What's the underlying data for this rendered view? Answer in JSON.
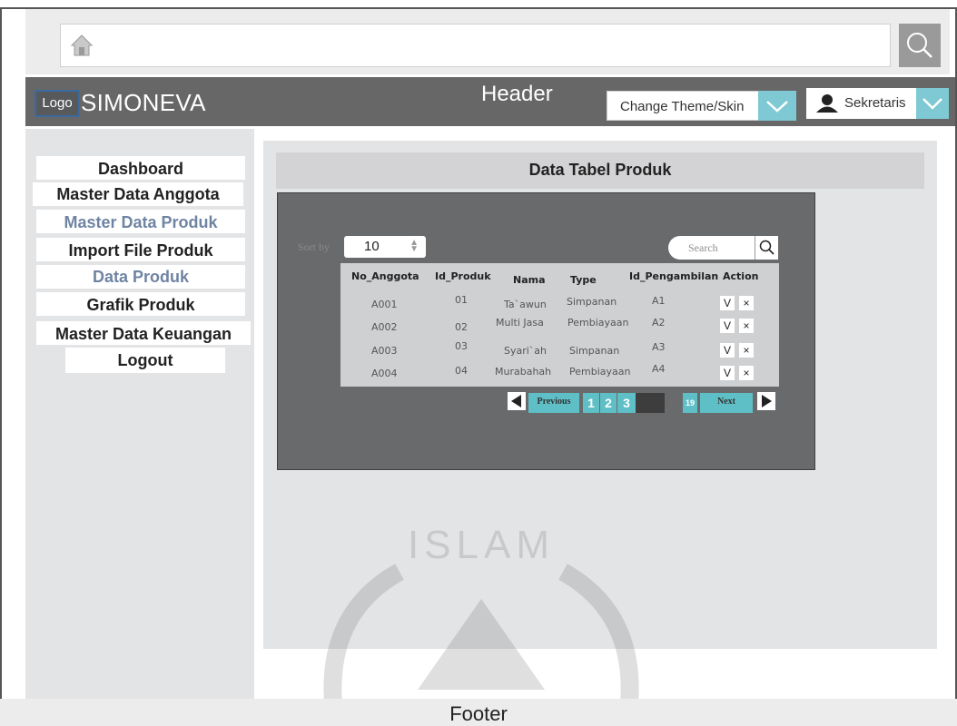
{
  "app": {
    "logo": "Logo",
    "name": "SIMONEVA",
    "header_label": "Header",
    "footer_label": "Footer"
  },
  "header": {
    "theme_button": "Change Theme/Skin",
    "user": "Sekretaris"
  },
  "sidebar": {
    "items": [
      {
        "label": "Dashboard",
        "active": false
      },
      {
        "label": "Master Data Anggota",
        "active": false
      },
      {
        "label": "Master Data Produk",
        "active": true
      },
      {
        "label": "Import File Produk",
        "active": false
      },
      {
        "label": "Data Produk",
        "active": true
      },
      {
        "label": "Grafik Produk",
        "active": false
      },
      {
        "label": "Master Data Keuangan",
        "active": false
      },
      {
        "label": "Logout",
        "active": false
      }
    ]
  },
  "main": {
    "title": "Data Tabel Produk",
    "sort_label": "Sort by",
    "sort_value": "10",
    "search_placeholder": "Search",
    "table": {
      "columns": [
        "No_Anggota",
        "Id_Produk",
        "Nama",
        "Type",
        "Id_Pengambilan",
        "Action"
      ],
      "rows": [
        [
          "A001",
          "01",
          "Ta`awun",
          "Simpanan",
          "A1"
        ],
        [
          "A002",
          "02",
          "Multi Jasa",
          "Pembiayaan",
          "A2"
        ],
        [
          "A003",
          "03",
          "Syari`ah",
          "Simpanan",
          "A3"
        ],
        [
          "A004",
          "04",
          "Murabahah",
          "Pembiayaan",
          "A4"
        ]
      ],
      "action_approve": "V",
      "action_reject": "×"
    },
    "pagination": {
      "previous": "Previous",
      "pages": [
        "1",
        "2",
        "3"
      ],
      "of_label": "of",
      "total": "19",
      "next": "Next"
    }
  },
  "watermark_text": "ISLAM",
  "colors": {
    "header": "#676767",
    "accent": "#7ec9d3",
    "active_menu": "#6f84a3",
    "panel": "#696a6c"
  }
}
